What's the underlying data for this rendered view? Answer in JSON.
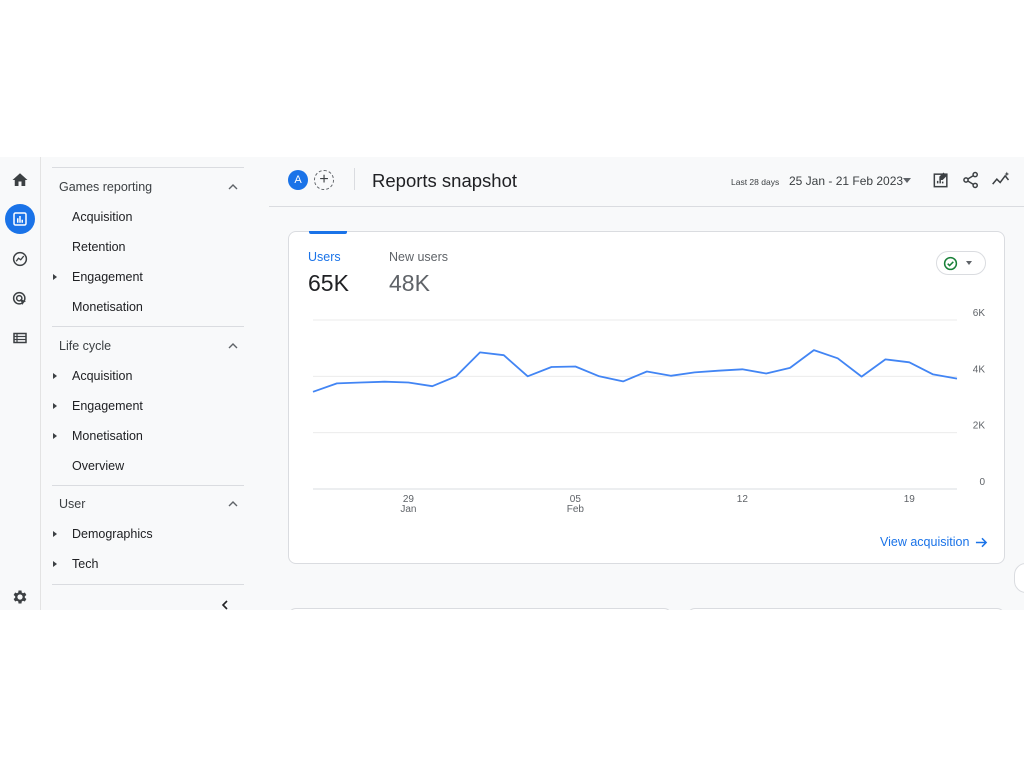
{
  "rail": {
    "items": [
      {
        "icon": "home-icon",
        "active": false
      },
      {
        "icon": "reports-icon",
        "active": true
      },
      {
        "icon": "explore-icon",
        "active": false
      },
      {
        "icon": "advertising-icon",
        "active": false
      },
      {
        "icon": "configure-icon",
        "active": false
      }
    ],
    "settings_icon": "gear-icon"
  },
  "nav": {
    "sections": [
      {
        "title": "Games reporting",
        "items": [
          {
            "label": "Acquisition",
            "expandable": false
          },
          {
            "label": "Retention",
            "expandable": false
          },
          {
            "label": "Engagement",
            "expandable": true
          },
          {
            "label": "Monetisation",
            "expandable": false
          }
        ]
      },
      {
        "title": "Life cycle",
        "items": [
          {
            "label": "Acquisition",
            "expandable": true
          },
          {
            "label": "Engagement",
            "expandable": true
          },
          {
            "label": "Monetisation",
            "expandable": true
          },
          {
            "label": "Overview",
            "expandable": false
          }
        ]
      },
      {
        "title": "User",
        "items": [
          {
            "label": "Demographics",
            "expandable": true
          },
          {
            "label": "Tech",
            "expandable": true
          }
        ]
      }
    ]
  },
  "header": {
    "avatar_letter": "A",
    "add_comparison": "+",
    "title": "Reports snapshot",
    "date_label": "Last 28 days",
    "date_range": "25 Jan - 21 Feb 2023"
  },
  "card": {
    "metrics": [
      {
        "label": "Users",
        "value": "65K"
      },
      {
        "label": "New users",
        "value": "48K"
      }
    ],
    "link_label": "View acquisition"
  },
  "colors": {
    "accent": "#1a73e8",
    "line": "#4285f4",
    "ok": "#188038"
  },
  "chart_data": {
    "type": "line",
    "series": [
      {
        "name": "Users",
        "values": [
          3450,
          3750,
          3780,
          3810,
          3780,
          3650,
          4000,
          4850,
          4750,
          4000,
          4330,
          4350,
          4000,
          3820,
          4170,
          4020,
          4140,
          4200,
          4250,
          4100,
          4300,
          4930,
          4640,
          3990,
          4600,
          4500,
          4070,
          3920
        ]
      }
    ],
    "x_tick_labels": [
      {
        "index": 4,
        "day": "29",
        "month": "Jan"
      },
      {
        "index": 11,
        "day": "05",
        "month": "Feb"
      },
      {
        "index": 18,
        "day": "12",
        "month": ""
      },
      {
        "index": 25,
        "day": "19",
        "month": ""
      }
    ],
    "y_ticks": [
      "0",
      "2K",
      "4K",
      "6K"
    ],
    "ylim": [
      0,
      6000
    ],
    "grid": true
  }
}
